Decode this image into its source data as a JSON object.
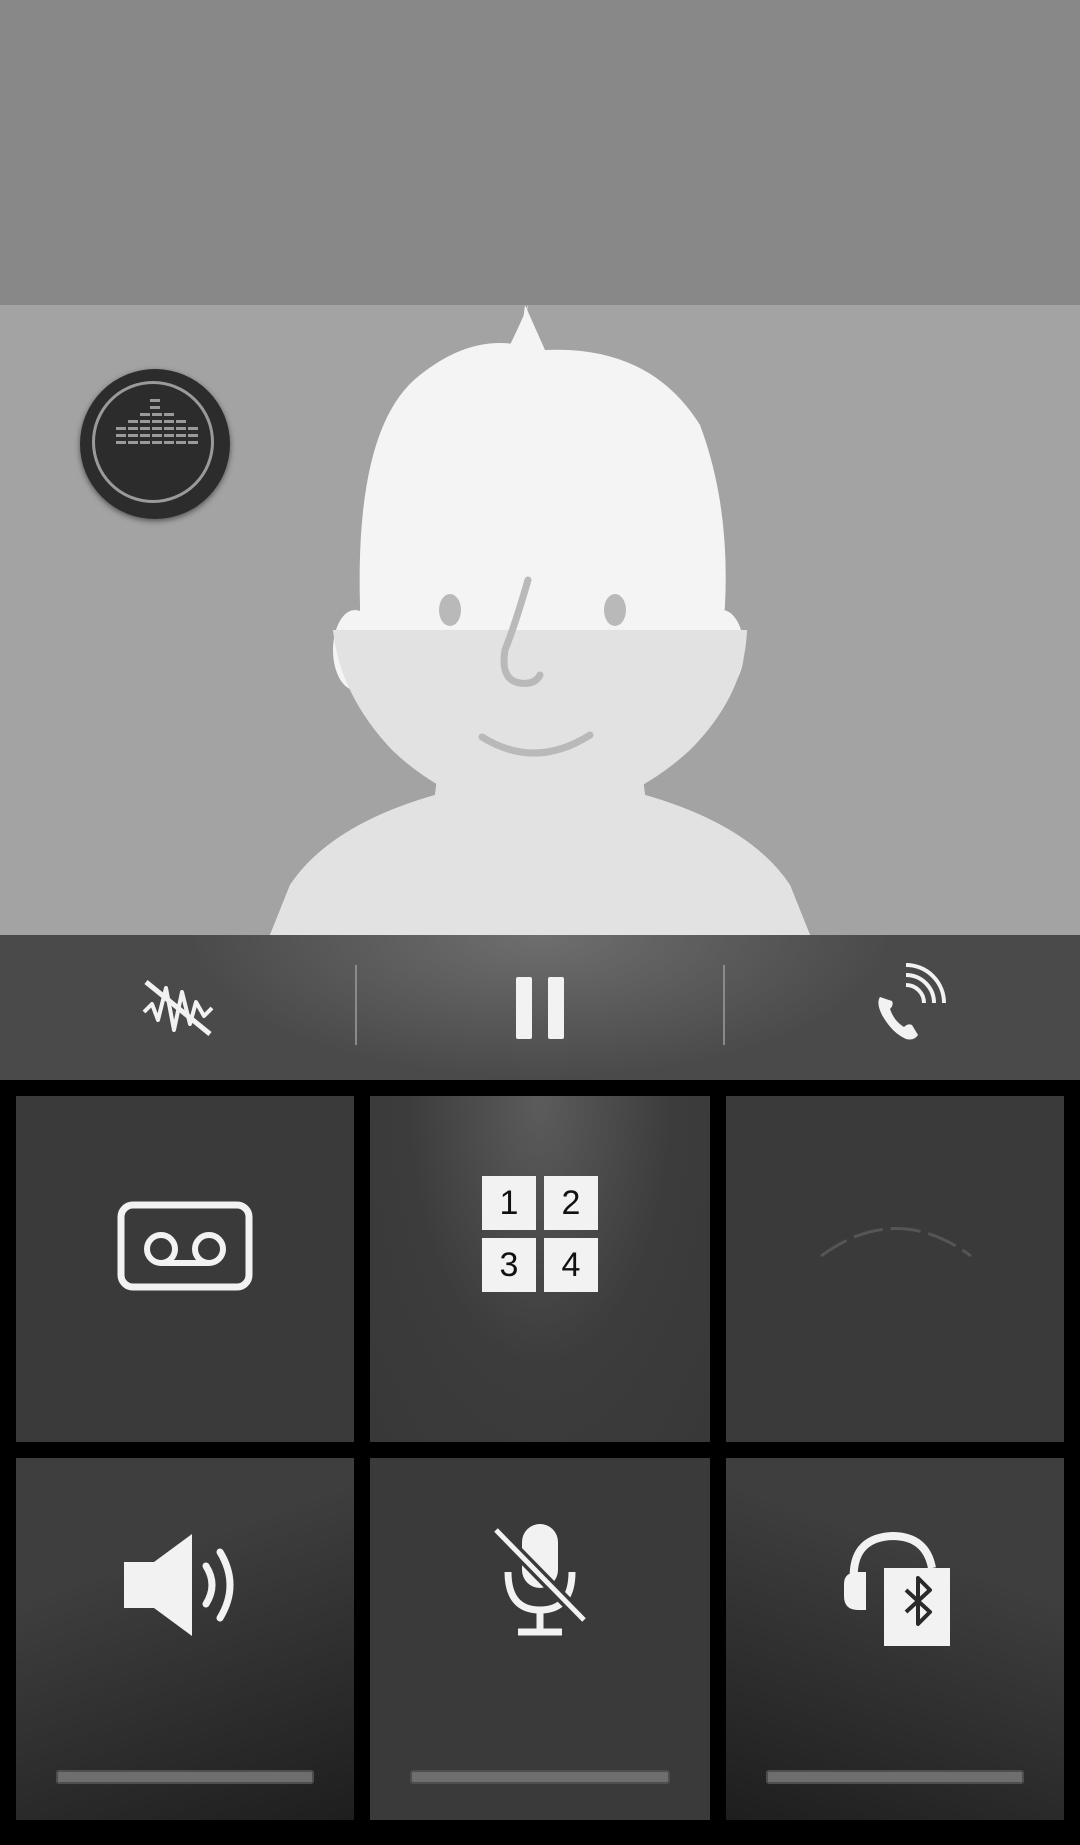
{
  "contact": {
    "photo": "default-avatar-icon"
  },
  "hd_voice_badge": {
    "icon": "hd-voice-icon"
  },
  "call_actions": [
    {
      "id": "noise-reduction",
      "icon": "noise-reduction-off-icon"
    },
    {
      "id": "hold",
      "icon": "pause-icon"
    },
    {
      "id": "add-call",
      "icon": "phone-wifi-call-icon"
    }
  ],
  "grid_buttons": [
    {
      "id": "voicemail",
      "icon": "voicemail-icon"
    },
    {
      "id": "keypad",
      "icon": "keypad-icon",
      "digits": [
        "1",
        "2",
        "3",
        "4"
      ]
    },
    {
      "id": "empty",
      "icon": ""
    },
    {
      "id": "speaker",
      "icon": "speaker-icon",
      "indicator": "off"
    },
    {
      "id": "mute",
      "icon": "mic-muted-icon",
      "indicator": "off"
    },
    {
      "id": "bluetooth",
      "icon": "bluetooth-headset-icon",
      "indicator": "off"
    }
  ],
  "colors": {
    "top_band": "#888888",
    "photo_bg": "#a3a3a3",
    "avatar": "#f4f4f4",
    "avatar_lower": "#e2e2e2",
    "tile": "#3a3a3a"
  }
}
